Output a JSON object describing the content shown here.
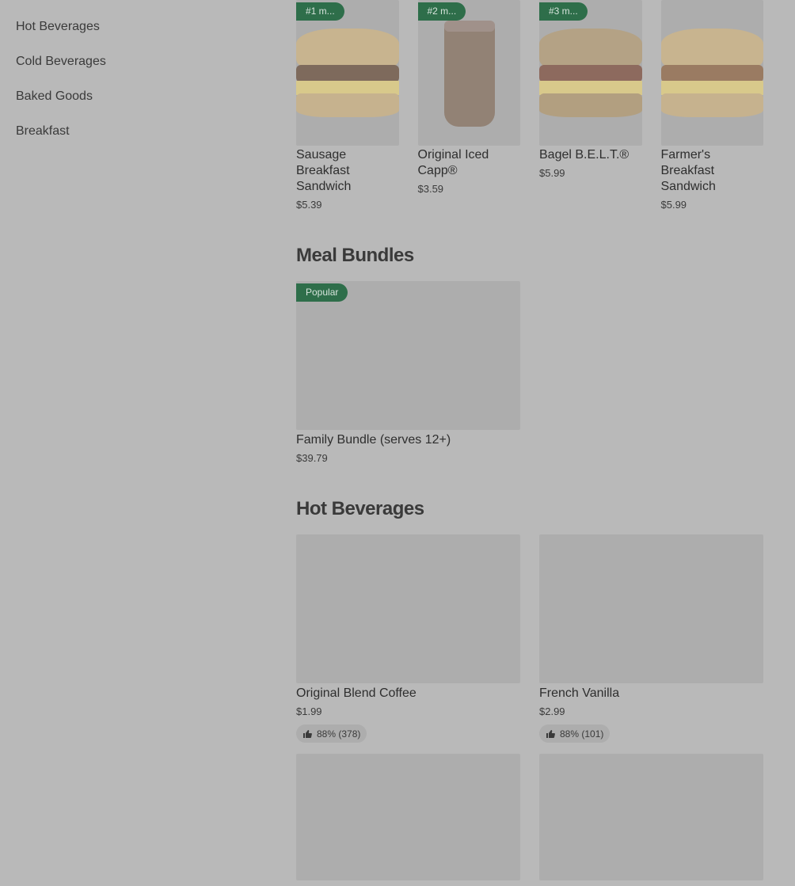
{
  "sidebar": {
    "items": [
      {
        "label": "Hot Beverages"
      },
      {
        "label": "Cold Beverages"
      },
      {
        "label": "Baked Goods"
      },
      {
        "label": "Breakfast"
      }
    ]
  },
  "top_items": [
    {
      "badge": "#1 m...",
      "name": "Sausage Breakfast Sandwich",
      "price": "$5.39"
    },
    {
      "badge": "#2 m...",
      "name": "Original Iced Capp®",
      "price": "$3.59"
    },
    {
      "badge": "#3 m...",
      "name": "Bagel B.E.L.T.®",
      "price": "$5.99"
    },
    {
      "badge": "",
      "name": "Farmer's Breakfast Sandwich",
      "price": "$5.99"
    }
  ],
  "meal_bundles": {
    "title": "Meal Bundles",
    "items": [
      {
        "badge": "Popular",
        "name": "Family Bundle (serves 12+)",
        "price": "$39.79"
      }
    ]
  },
  "hot_beverages": {
    "title": "Hot Beverages",
    "items": [
      {
        "name": "Original Blend Coffee",
        "price": "$1.99",
        "rating": "88% (378)"
      },
      {
        "name": "French Vanilla",
        "price": "$2.99",
        "rating": "88% (101)"
      }
    ]
  },
  "colors": {
    "overlay_bg": "#b9b9b9",
    "badge_bg": "#2e6e4a",
    "placeholder": "#adadad"
  }
}
